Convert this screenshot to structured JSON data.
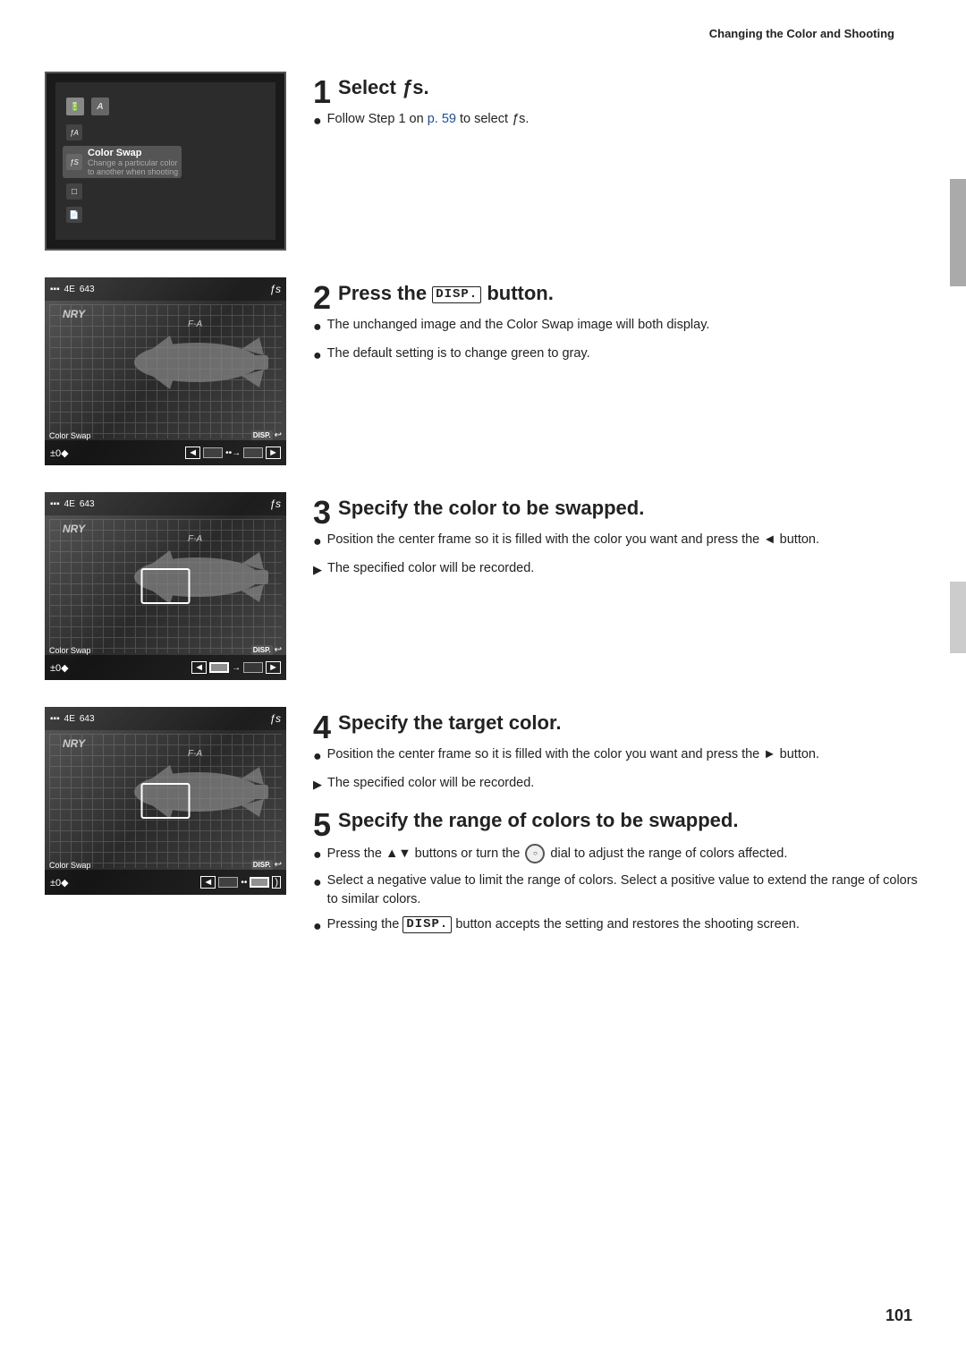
{
  "header": {
    "title": "Changing the Color and Shooting"
  },
  "page_number": "101",
  "steps": [
    {
      "number": "1",
      "title": "Select ",
      "title_symbol": "ƒs",
      "bullets": [
        {
          "type": "circle",
          "text_parts": [
            "Follow Step 1 on ",
            "p. 59",
            " to select ",
            "ƒs",
            "."
          ],
          "has_link": true,
          "link_text": "p. 59"
        }
      ]
    },
    {
      "number": "2",
      "title": "Press the DISP. button.",
      "bullets": [
        {
          "type": "circle",
          "text": "The unchanged image and the Color Swap image will both display."
        },
        {
          "type": "circle",
          "text": "The default setting is to change green to gray."
        }
      ]
    },
    {
      "number": "3",
      "title": "Specify the color to be swapped.",
      "bullets": [
        {
          "type": "circle",
          "text": "Position the center frame so it is filled with the color you want and press the ◄ button."
        },
        {
          "type": "arrow",
          "text": "The specified color will be recorded."
        }
      ]
    },
    {
      "number": "4",
      "title": "Specify the target color.",
      "bullets": [
        {
          "type": "circle",
          "text": "Position the center frame so it is filled with the color you want and press the ► button."
        },
        {
          "type": "arrow",
          "text": "The specified color will be recorded."
        }
      ]
    },
    {
      "number": "5",
      "title": "Specify the range of colors to be swapped.",
      "bullets": [
        {
          "type": "circle",
          "text_parts": [
            "Press the ▲▼ buttons or turn the ",
            "dial",
            " dial to adjust the range of colors affected."
          ]
        },
        {
          "type": "circle",
          "text": "Select a negative value to limit the range of colors. Select a positive value to extend the range of colors to similar colors."
        },
        {
          "type": "circle",
          "text_parts": [
            "Pressing the ",
            "DISP.",
            " button accepts the setting and restores the shooting screen."
          ]
        }
      ]
    }
  ],
  "camera_screens": [
    {
      "id": "screen1",
      "type": "menu"
    },
    {
      "id": "screen2",
      "type": "camera_view",
      "top_left": "777 4E 643",
      "bottom_label": "Color Swap",
      "disp": "DISP.",
      "bottom_value": "±0"
    },
    {
      "id": "screen3",
      "type": "camera_view_reticle",
      "top_left": "777 4E 643",
      "bottom_label": "Color Swap",
      "disp": "DISP.",
      "bottom_value": "±0"
    },
    {
      "id": "screen4",
      "type": "camera_view_reticle2",
      "top_left": "777 4E 643",
      "bottom_label": "Color Swap",
      "disp": "DISP.",
      "bottom_value": "±0"
    }
  ],
  "menu_items": [
    {
      "icon": "battery",
      "label": ""
    },
    {
      "icon": "flash_a",
      "label": "ƒA",
      "desc": ""
    },
    {
      "icon": "fs_selected",
      "label": "ƒS",
      "desc": "Color Swap",
      "sub": "Change a particular color\nto another when shooting",
      "selected": true
    },
    {
      "icon": "square",
      "label": ""
    },
    {
      "icon": "doc",
      "label": ""
    }
  ]
}
